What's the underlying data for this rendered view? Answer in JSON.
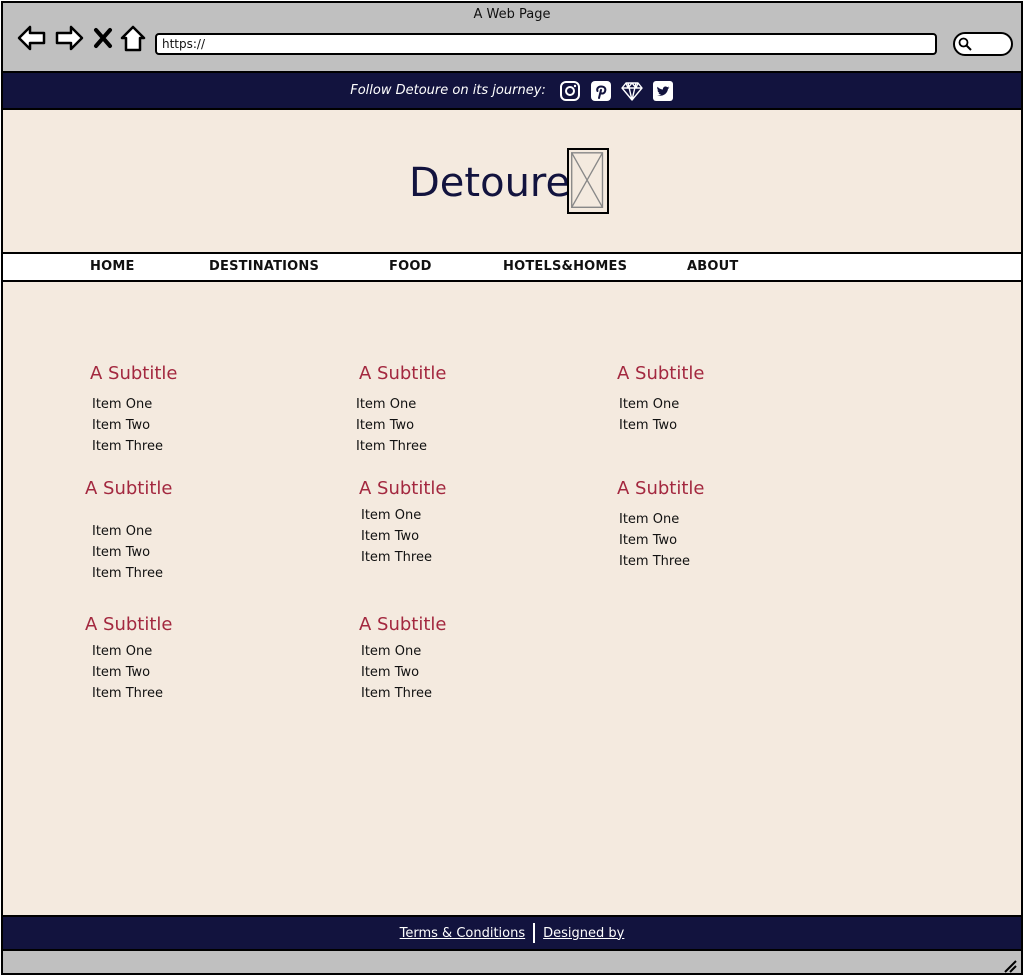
{
  "window": {
    "title": "A Web Page"
  },
  "toolbar": {
    "back_icon": "back-arrow-icon",
    "forward_icon": "forward-arrow-icon",
    "stop_icon": "close-icon",
    "home_icon": "home-icon",
    "address": "https://",
    "search_icon": "search-icon"
  },
  "topbar": {
    "follow_text": "Follow Detoure on its journey:",
    "social_icons": [
      "instagram-icon",
      "pinterest-icon",
      "diamond-icon",
      "twitter-icon"
    ]
  },
  "header": {
    "brand": "Detoure"
  },
  "nav": {
    "items": [
      "HOME",
      "DESTINATIONS",
      "FOOD",
      "HOTELS&HOMES",
      "ABOUT"
    ]
  },
  "sections": [
    {
      "title": "A Subtitle",
      "items": [
        "Item One",
        "Item Two",
        "Item Three"
      ]
    },
    {
      "title": "A Subtitle",
      "items": [
        "Item One",
        "Item Two",
        "Item Three"
      ]
    },
    {
      "title": "A Subtitle",
      "items": [
        "Item One",
        "Item Two"
      ]
    },
    {
      "title": "A Subtitle",
      "items": [
        "Item One",
        "Item Two",
        "Item Three"
      ]
    },
    {
      "title": "A Subtitle",
      "items": [
        "Item One",
        "Item Two",
        "Item Three"
      ]
    },
    {
      "title": "A Subtitle",
      "items": [
        "Item One",
        "Item Two",
        "Item Three"
      ]
    },
    {
      "title": "A Subtitle",
      "items": [
        "Item One",
        "Item Two",
        "Item Three"
      ]
    },
    {
      "title": "A Subtitle",
      "items": [
        "Item One",
        "Item Two",
        "Item Three"
      ]
    }
  ],
  "footer": {
    "terms": "Terms & Conditions",
    "designed_by": "Designed by"
  },
  "colors": {
    "navy": "#12133e",
    "cream": "#f4eadf",
    "subtitle": "#a3283f"
  }
}
